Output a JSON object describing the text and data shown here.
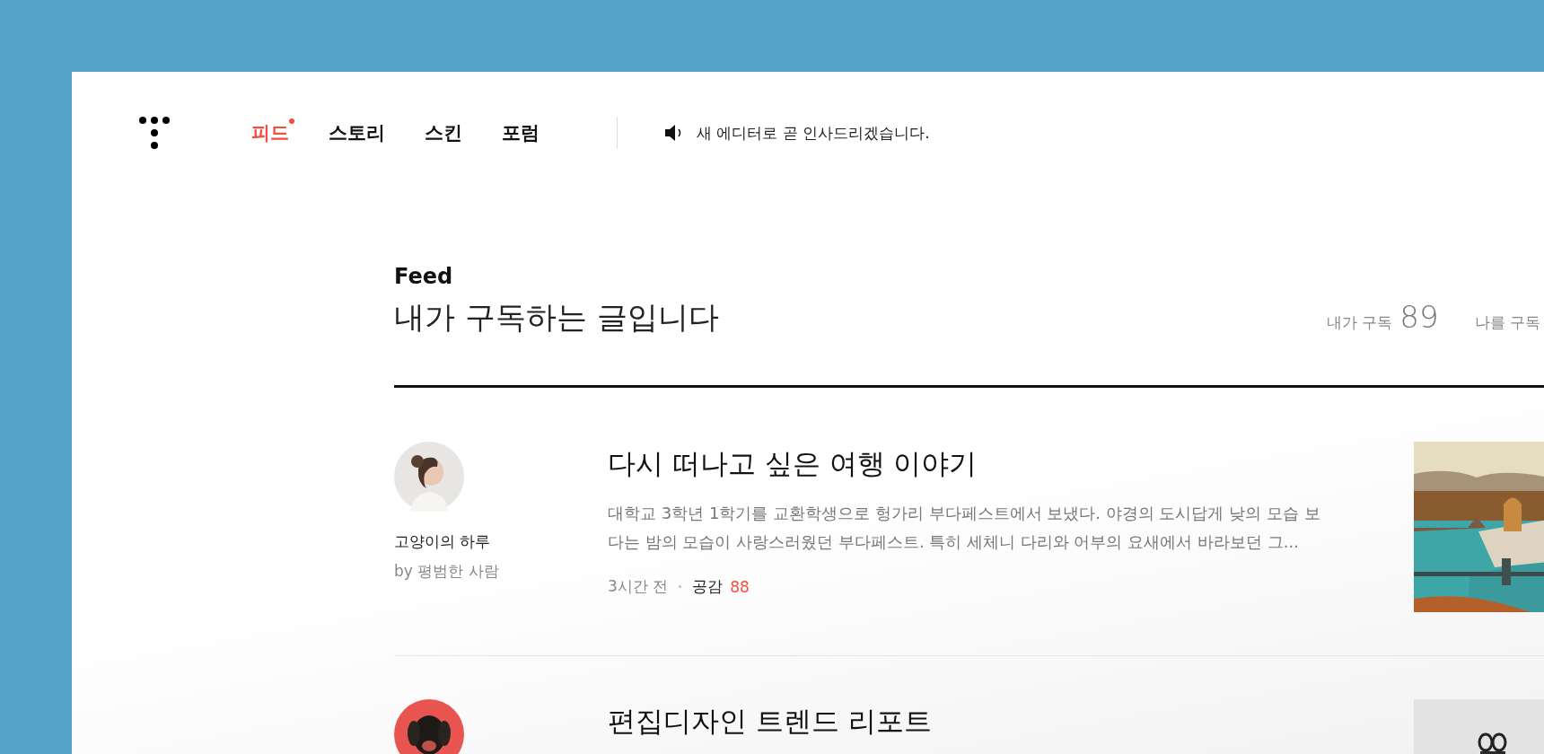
{
  "nav": [
    {
      "label": "피드",
      "selected": true,
      "new": true
    },
    {
      "label": "스토리",
      "selected": false,
      "new": false
    },
    {
      "label": "스킨",
      "selected": false,
      "new": false
    },
    {
      "label": "포럼",
      "selected": false,
      "new": false
    }
  ],
  "notice": "새 에디터로 곧 인사드리겠습니다.",
  "feed": {
    "title": "Feed",
    "subtitle": "내가 구독하는 글입니다",
    "stats": [
      {
        "label": "내가 구독",
        "count": "89"
      },
      {
        "label": "나를 구독"
      }
    ]
  },
  "posts": [
    {
      "blog": "고양이의 하루",
      "author": "by 평범한 사람",
      "title": "다시 떠나고 싶은 여행 이야기",
      "excerpt": "대학교 3학년 1학기를 교환학생으로 헝가리 부다페스트에서 보냈다. 야경의 도시답게 낮의 모습 보다는 밤의 모습이 사랑스러웠던 부다페스트. 특히 세체니 다리와 어부의 요새에서 바라보던 그...",
      "time": "3시간 전",
      "likes_label": "공감",
      "likes": "88"
    },
    {
      "title": "편집디자인 트렌드 리포트"
    }
  ]
}
